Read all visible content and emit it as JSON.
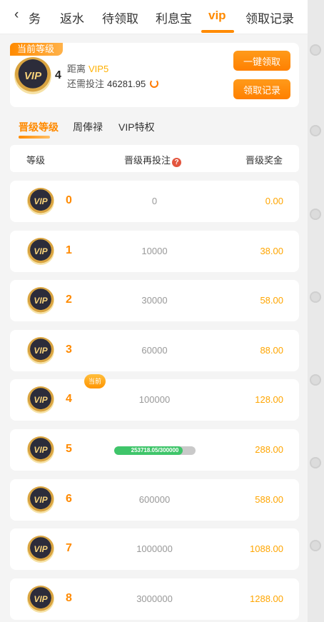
{
  "nav": {
    "back_glyph": "‹",
    "tabs": [
      "务",
      "返水",
      "待领取",
      "利息宝",
      "vip",
      "领取记录"
    ],
    "active_tab": "vip"
  },
  "current": {
    "tag": "当前等级",
    "level": "4",
    "distance_label": "距离",
    "distance_target": "VIP5",
    "need_label": "还需投注",
    "need_value": "46281.95",
    "claim_button": "一键领取",
    "record_button": "领取记录"
  },
  "subtabs": [
    "晋级等级",
    "周俸禄",
    "VIP特权"
  ],
  "table": {
    "headers": {
      "level": "等级",
      "requirement": "晋级再投注",
      "help": "?",
      "bonus": "晋级奖金"
    },
    "badge_text": "VIP",
    "current_tag": "当前",
    "rows": [
      {
        "level": "0",
        "req": "0",
        "bonus": "0.00"
      },
      {
        "level": "1",
        "req": "10000",
        "bonus": "38.00"
      },
      {
        "level": "2",
        "req": "30000",
        "bonus": "58.00"
      },
      {
        "level": "3",
        "req": "60000",
        "bonus": "88.00"
      },
      {
        "level": "4",
        "req": "100000",
        "bonus": "128.00"
      },
      {
        "level": "5",
        "req": "253718.05/300000",
        "bonus": "288.00",
        "progress": 0.846
      },
      {
        "level": "6",
        "req": "600000",
        "bonus": "588.00"
      },
      {
        "level": "7",
        "req": "1000000",
        "bonus": "1088.00"
      },
      {
        "level": "8",
        "req": "3000000",
        "bonus": "1288.00"
      }
    ]
  },
  "colors": {
    "accent": "#ff8a00",
    "bonus": "#ffa500",
    "progress": "#3fc56a"
  }
}
